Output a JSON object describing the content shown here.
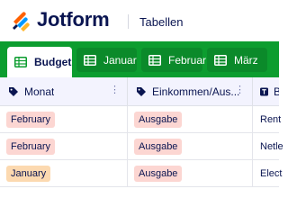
{
  "header": {
    "brand": "Jotform",
    "subtitle": "Tabellen"
  },
  "tabs": [
    {
      "label": "Budget",
      "active": true
    },
    {
      "label": "Januar",
      "active": false
    },
    {
      "label": "Februar",
      "active": false
    },
    {
      "label": "März",
      "active": false
    }
  ],
  "columns": [
    {
      "label": "Monat",
      "icon": "tag-icon"
    },
    {
      "label": "Einkommen/Aus...",
      "icon": "tag-icon"
    },
    {
      "label": "B",
      "icon": "text-icon"
    }
  ],
  "rows": [
    {
      "month": "February",
      "month_color": "#fcd6d2",
      "type": "Ausgabe",
      "type_color": "#fcd6d2",
      "desc": "Rent"
    },
    {
      "month": "February",
      "month_color": "#fcd6d2",
      "type": "Ausgabe",
      "type_color": "#fcd6d2",
      "desc": "Netle"
    },
    {
      "month": "January",
      "month_color": "#fcd9b0",
      "type": "Ausgabe",
      "type_color": "#fcd6d2",
      "desc": "Elect"
    }
  ],
  "colors": {
    "tabbar": "#0c9d2f",
    "brand_text": "#0a1551",
    "header_row": "#f3f3fe"
  }
}
